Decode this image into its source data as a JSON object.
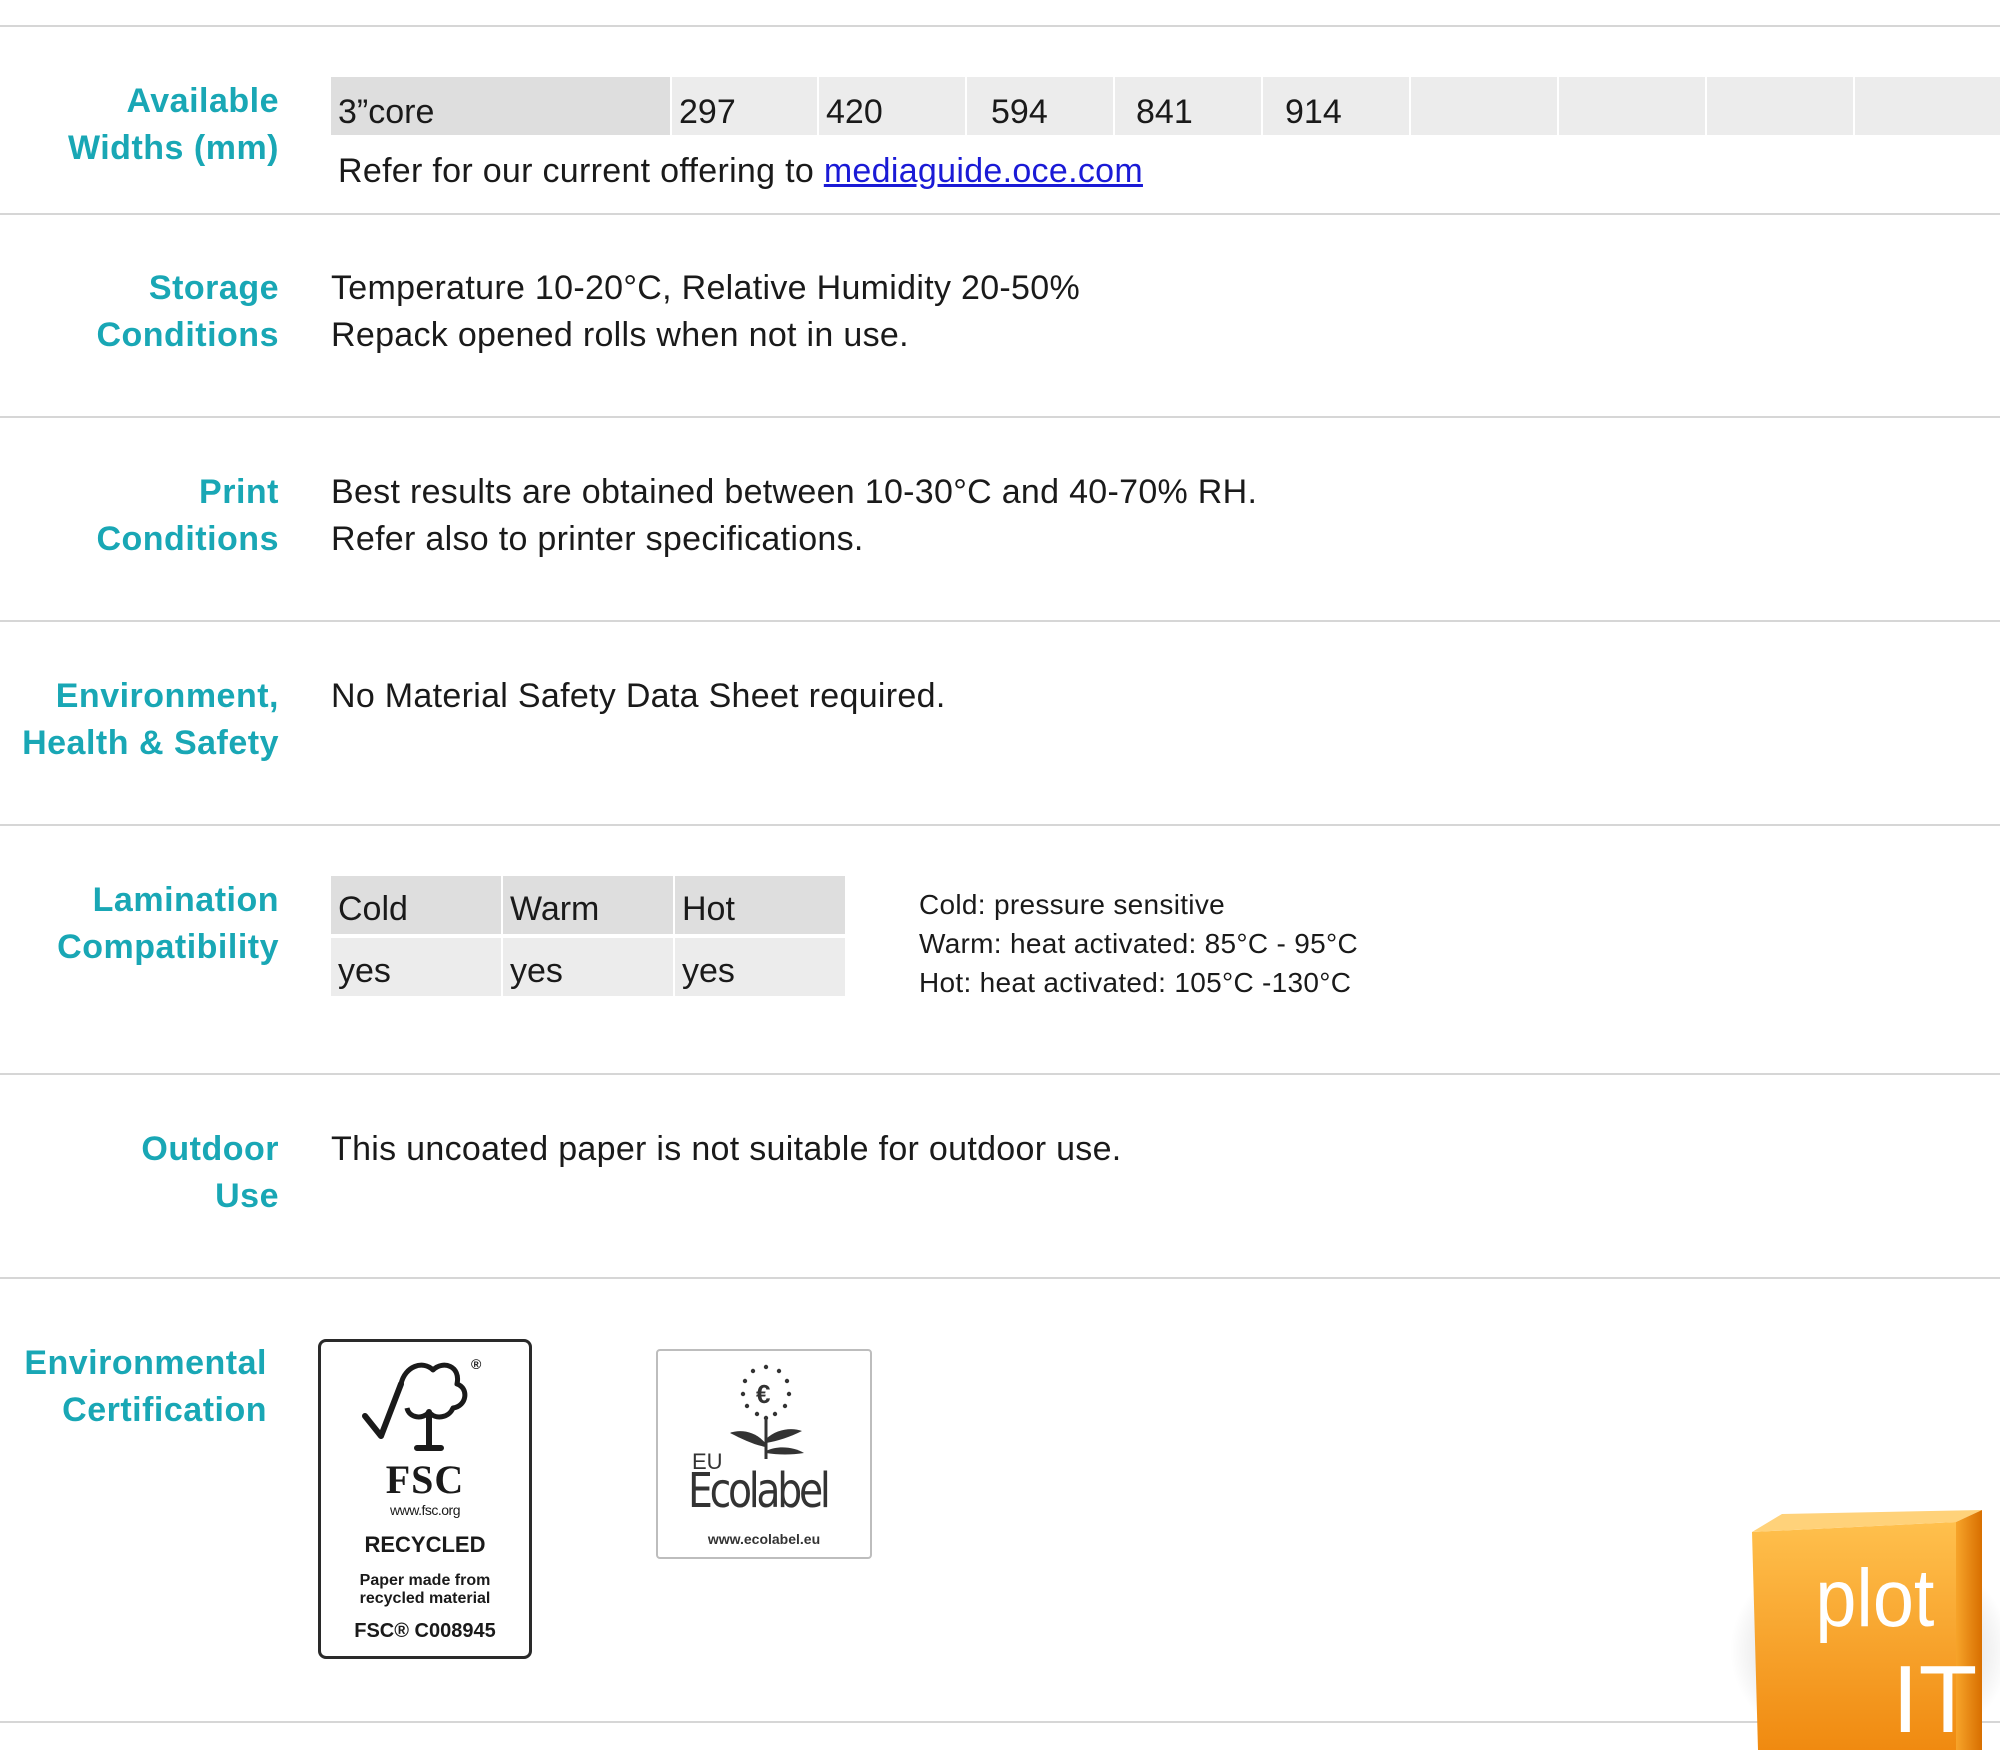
{
  "widths": {
    "label_line1": "Available",
    "label_line2": "Widths (mm)",
    "core": "3”core",
    "values": [
      "297",
      "420",
      "594",
      "841",
      "914",
      "",
      "",
      "",
      ""
    ],
    "refer_text": "Refer for our current offering to ",
    "refer_link": "mediaguide.oce.com"
  },
  "storage": {
    "label_line1": "Storage",
    "label_line2": "Conditions",
    "line1": "Temperature 10-20°C, Relative Humidity 20-50%",
    "line2": "Repack opened rolls when not in use."
  },
  "print": {
    "label_line1": "Print",
    "label_line2": "Conditions",
    "line1": "Best results are obtained between 10-30°C and 40-70% RH.",
    "line2": "Refer also to printer specifications."
  },
  "ehs": {
    "label_line1": "Environment,",
    "label_line2": "Health & Safety",
    "line1": "No Material Safety Data Sheet required."
  },
  "lamination": {
    "label_line1": "Lamination",
    "label_line2": "Compatibility",
    "headers": [
      "Cold",
      "Warm",
      "Hot"
    ],
    "values": [
      "yes",
      "yes",
      "yes"
    ],
    "notes": [
      "Cold: pressure sensitive",
      "Warm: heat activated: 85°C - 95°C",
      "Hot: heat activated: 105°C -130°C"
    ]
  },
  "outdoor": {
    "label_line1": "Outdoor",
    "label_line2": "Use",
    "line1": "This uncoated paper is not suitable for outdoor use."
  },
  "certification": {
    "label_line1": "Environmental",
    "label_line2": "Certification",
    "fsc": {
      "mark": "FSC",
      "url": "www.fsc.org",
      "recycled": "RECYCLED",
      "desc_line1": "Paper made from",
      "desc_line2": "recycled material",
      "code": "FSC® C008945",
      "registered": "®"
    },
    "ecolabel": {
      "eu": "EU",
      "name": "Ecolabel",
      "url": "www.ecolabel.eu",
      "euro": "€"
    }
  },
  "brand": {
    "line1": "plot",
    "line2": "IT",
    "color": "#f7941d"
  },
  "colors": {
    "label": "#19a7b5",
    "link": "#1a1ad6",
    "cell_dark": "#dedede",
    "cell_light": "#ececec",
    "rule": "#d6d6d6"
  }
}
